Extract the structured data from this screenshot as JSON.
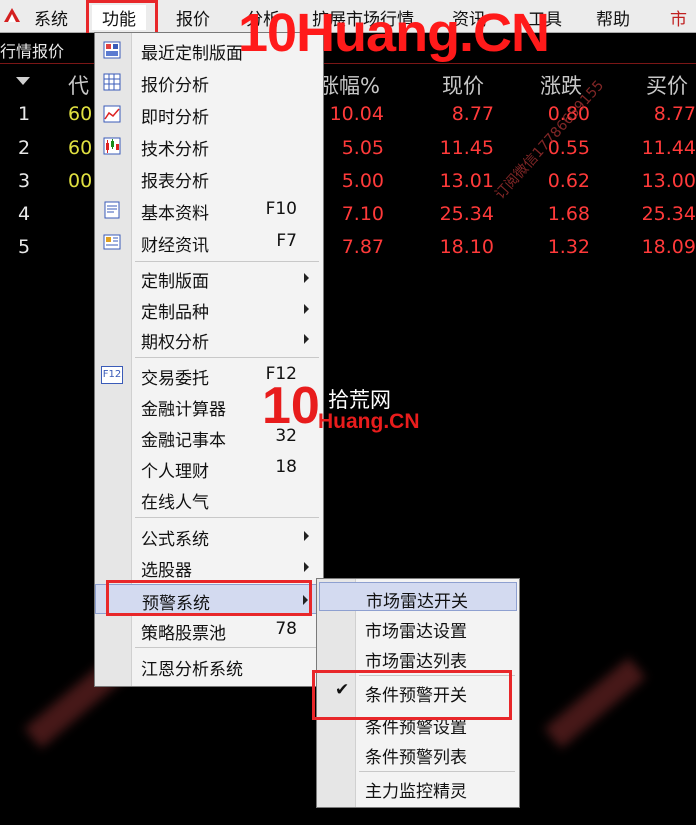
{
  "menubar": {
    "items": [
      {
        "label": "系统"
      },
      {
        "label": "功能"
      },
      {
        "label": "报价"
      },
      {
        "label": "分析"
      },
      {
        "label": "扩展市场行情"
      },
      {
        "label": "资讯"
      },
      {
        "label": "工具"
      },
      {
        "label": "帮助"
      },
      {
        "label": "市"
      }
    ]
  },
  "quote_panel": {
    "title": "行情报价",
    "headers": {
      "code": "代",
      "change_pct": "涨幅%",
      "price": "现价",
      "change": "涨跌",
      "bid": "买价"
    },
    "rows": [
      {
        "idx": "1",
        "code": "60",
        "change_pct": "10.04",
        "price": "8.77",
        "change": "0.80",
        "bid": "8.77"
      },
      {
        "idx": "2",
        "code": "60",
        "change_pct": "5.05",
        "price": "11.45",
        "change": "0.55",
        "bid": "11.44"
      },
      {
        "idx": "3",
        "code": "00",
        "change_pct": "5.00",
        "price": "13.01",
        "change": "0.62",
        "bid": "13.00"
      },
      {
        "idx": "4",
        "code": "",
        "change_pct": "7.10",
        "price": "25.34",
        "change": "1.68",
        "bid": "25.34"
      },
      {
        "idx": "5",
        "code": "",
        "change_pct": "7.87",
        "price": "18.10",
        "change": "1.32",
        "bid": "18.09"
      }
    ]
  },
  "function_menu": {
    "items": [
      {
        "label": "最近定制版面",
        "shortcut": ""
      },
      {
        "label": "报价分析",
        "shortcut": ""
      },
      {
        "label": "即时分析",
        "shortcut": ""
      },
      {
        "label": "技术分析",
        "shortcut": ""
      },
      {
        "label": "报表分析",
        "shortcut": ""
      },
      {
        "label": "基本资料",
        "shortcut": "F10"
      },
      {
        "label": "财经资讯",
        "shortcut": "F7"
      },
      {
        "label": "定制版面",
        "shortcut": ""
      },
      {
        "label": "定制品种",
        "shortcut": ""
      },
      {
        "label": "期权分析",
        "shortcut": ""
      },
      {
        "label": "交易委托",
        "shortcut": "F12"
      },
      {
        "label": "金融计算器",
        "shortcut": ""
      },
      {
        "label": "金融记事本",
        "shortcut": "32"
      },
      {
        "label": "个人理财",
        "shortcut": "18"
      },
      {
        "label": "在线人气",
        "shortcut": ""
      },
      {
        "label": "公式系统",
        "shortcut": ""
      },
      {
        "label": "选股器",
        "shortcut": ""
      },
      {
        "label": "预警系统",
        "shortcut": ""
      },
      {
        "label": "策略股票池",
        "shortcut": "78"
      },
      {
        "label": "江恩分析系统",
        "shortcut": ""
      }
    ],
    "f12_icon_text": "F12"
  },
  "alert_submenu": {
    "items": [
      {
        "label": "市场雷达开关"
      },
      {
        "label": "市场雷达设置"
      },
      {
        "label": "市场雷达列表"
      },
      {
        "label": "条件预警开关"
      },
      {
        "label": "条件预警设置"
      },
      {
        "label": "条件预警列表"
      },
      {
        "label": "主力监控精灵"
      }
    ],
    "check_mark": "✔"
  },
  "watermark": {
    "main": "10Huang.CN",
    "diagonal": "订阅微信17786659155",
    "logo_number": "10",
    "logo_cn": "拾荒网",
    "logo_en": "Huang.CN"
  },
  "colors": {
    "accent_red": "#e8272a",
    "price_red": "#ff3a3a",
    "highlight": "#d3daf0"
  }
}
